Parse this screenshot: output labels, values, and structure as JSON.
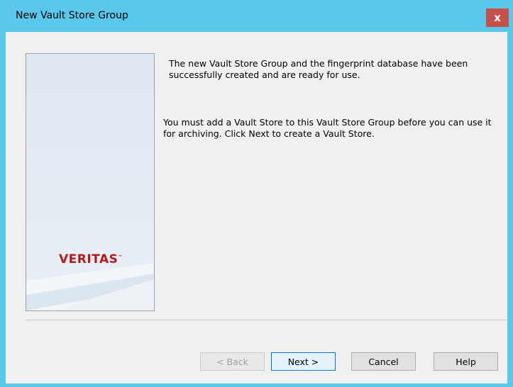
{
  "window": {
    "title": "New Vault Store Group",
    "close_glyph": "x"
  },
  "side_panel": {
    "logo_text": "VERITAS",
    "logo_mark": "™",
    "logo_color": "#b5191b"
  },
  "content": {
    "message1": "The new Vault Store Group and the fingerprint database have been successfully created and are ready for use.",
    "message2": "You must add a Vault Store to this Vault Store Group before you can use it for archiving. Click Next to create a Vault Store."
  },
  "buttons": {
    "back": "< Back",
    "next": "Next >",
    "cancel": "Cancel",
    "help": "Help"
  },
  "colors": {
    "titlebar": "#5ac8ea",
    "close": "#c7514a",
    "accent": "#0078d7"
  }
}
